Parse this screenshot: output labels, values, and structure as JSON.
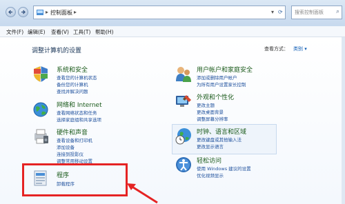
{
  "window": {
    "breadcrumb": "控制面板",
    "search_placeholder": "搜索控制面板"
  },
  "menu": [
    "文件(F)",
    "编辑(E)",
    "查看(V)",
    "工具(T)",
    "帮助(H)"
  ],
  "page": {
    "title": "调整计算机的设置",
    "view_by_label": "查看方式：",
    "view_by_value": "类别 ▾"
  },
  "left_categories": [
    {
      "title": "系统和安全",
      "links": [
        "查看您的计算机状态",
        "备份您的计算机",
        "查找并解决问题"
      ]
    },
    {
      "title": "网络和 Internet",
      "links": [
        "查看网络状态和任务",
        "选择家庭组和共享选项"
      ]
    },
    {
      "title": "硬件和声音",
      "links": [
        "查看设备和打印机",
        "添加设备",
        "连接到投影仪",
        "调整常用移动设置"
      ]
    },
    {
      "title": "程序",
      "links": [
        "卸载程序"
      ]
    }
  ],
  "right_categories": [
    {
      "title": "用户帐户和家庭安全",
      "links": [
        "添加或删除用户帐户",
        "为所有用户设置家长控制"
      ]
    },
    {
      "title": "外观和个性化",
      "links": [
        "更改主题",
        "更改桌面背景",
        "调整屏幕分辨率"
      ]
    },
    {
      "title": "时钟、语言和区域",
      "links": [
        "更改键盘或其他输入法",
        "更改显示语言"
      ]
    },
    {
      "title": "轻松访问",
      "links": [
        "使用 Windows 建议的设置",
        "优化视频显示"
      ]
    }
  ]
}
